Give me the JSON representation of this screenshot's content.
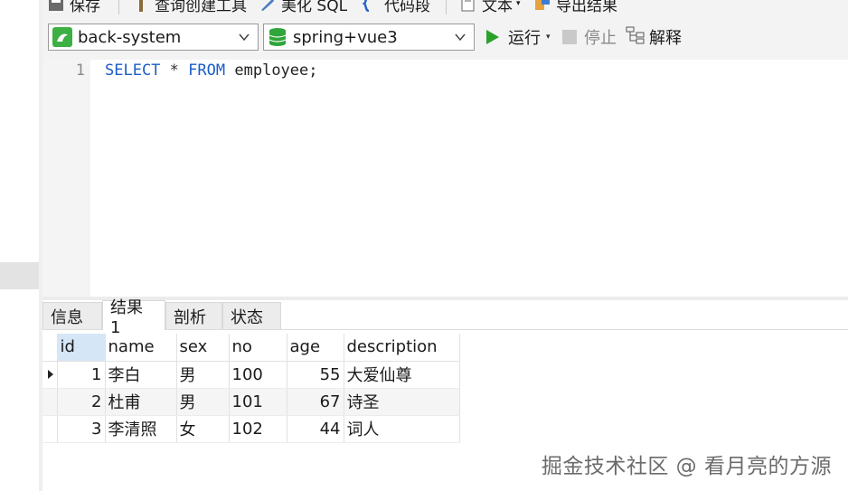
{
  "toolbar": {
    "items": [
      "保存",
      "查询创建工具",
      "美化 SQL",
      "代码段",
      "文本",
      "导出结果"
    ]
  },
  "selectors": {
    "connection": "back-system",
    "database": "spring+vue3",
    "run": "运行",
    "stop": "停止",
    "explain": "解释"
  },
  "editor": {
    "line_number": "1",
    "tokens": {
      "kw1": "SELECT",
      "star": "*",
      "kw2": "FROM",
      "table": "employee;"
    }
  },
  "tabs": [
    "信息",
    "结果 1",
    "剖析",
    "状态"
  ],
  "results": {
    "columns": [
      "id",
      "name",
      "sex",
      "no",
      "age",
      "description"
    ],
    "rows": [
      [
        "1",
        "李白",
        "男",
        "100",
        "55",
        "大爱仙尊"
      ],
      [
        "2",
        "杜甫",
        "男",
        "101",
        "67",
        "诗圣"
      ],
      [
        "3",
        "李清照",
        "女",
        "102",
        "44",
        "词人"
      ]
    ]
  },
  "watermark": "掘金技术社区 @ 看月亮的方源",
  "colors": {
    "keyword": "#1c5cc7",
    "run_green": "#2aa12a",
    "selected_header": "#d5e6f7"
  }
}
